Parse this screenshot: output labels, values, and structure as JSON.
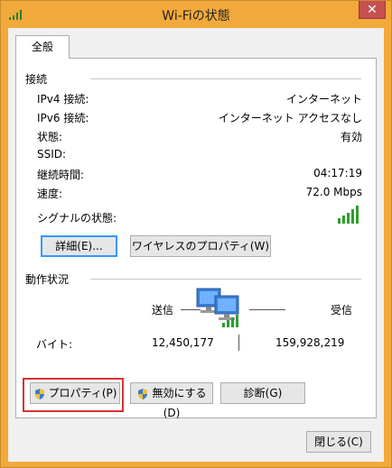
{
  "window": {
    "title": "Wi-Fiの状態",
    "close_label": "✕"
  },
  "tab": {
    "label": "全般"
  },
  "connection": {
    "section_title": "接続",
    "rows": [
      {
        "label": "IPv4 接続:",
        "value": "インターネット"
      },
      {
        "label": "IPv6 接続:",
        "value": "インターネット アクセスなし"
      },
      {
        "label": "状態:",
        "value": "有効"
      },
      {
        "label": "SSID:",
        "value": ""
      },
      {
        "label": "継続時間:",
        "value": "04:17:19"
      },
      {
        "label": "速度:",
        "value": "72.0 Mbps"
      }
    ],
    "signal_label": "シグナルの状態:",
    "signal_icon": "signal-bars-icon",
    "details_button": "詳細(E)...",
    "wireless_props_button": "ワイヤレスのプロパティ(W)"
  },
  "activity": {
    "section_title": "動作状況",
    "sent_label": "送信",
    "received_label": "受信",
    "bytes_label": "バイト:",
    "bytes_sent": "12,450,177",
    "bytes_received": "159,928,219",
    "icon": "network-computers-icon"
  },
  "actions": {
    "properties_button": "プロパティ(P)",
    "disable_button": "無効にする(D)",
    "diagnose_button": "診断(G)"
  },
  "footer": {
    "close_button": "閉じる(C)"
  },
  "colors": {
    "titlebar": "#f2a93b",
    "close": "#c75050",
    "signal": "#2e9e2e",
    "highlight": "#d93030"
  }
}
